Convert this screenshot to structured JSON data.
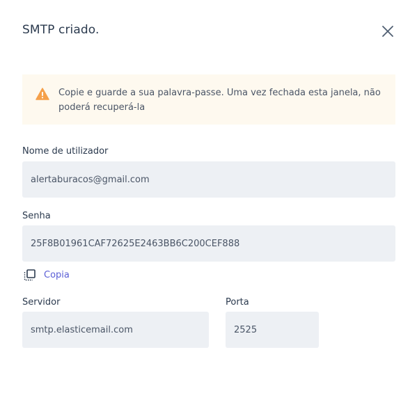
{
  "modal": {
    "title": "SMTP criado."
  },
  "alert": {
    "message": "Copie e guarde a sua palavra-passe. Uma vez fechada esta janela, não poderá recuperá-la",
    "color": "#f5a04a"
  },
  "fields": {
    "username": {
      "label": "Nome de utilizador",
      "value": "alertaburacos@gmail.com"
    },
    "password": {
      "label": "Senha",
      "value": "25F8B01961CAF72625E2463BB6C200CEF888"
    },
    "copy": {
      "label": "Copia"
    },
    "server": {
      "label": "Servidor",
      "value": "smtp.elasticemail.com"
    },
    "port": {
      "label": "Porta",
      "value": "2525"
    }
  },
  "colors": {
    "accent": "#5b5fd6",
    "field_bg": "#edf0f4",
    "alert_bg": "#fef9ef",
    "warning": "#f5a04a"
  }
}
